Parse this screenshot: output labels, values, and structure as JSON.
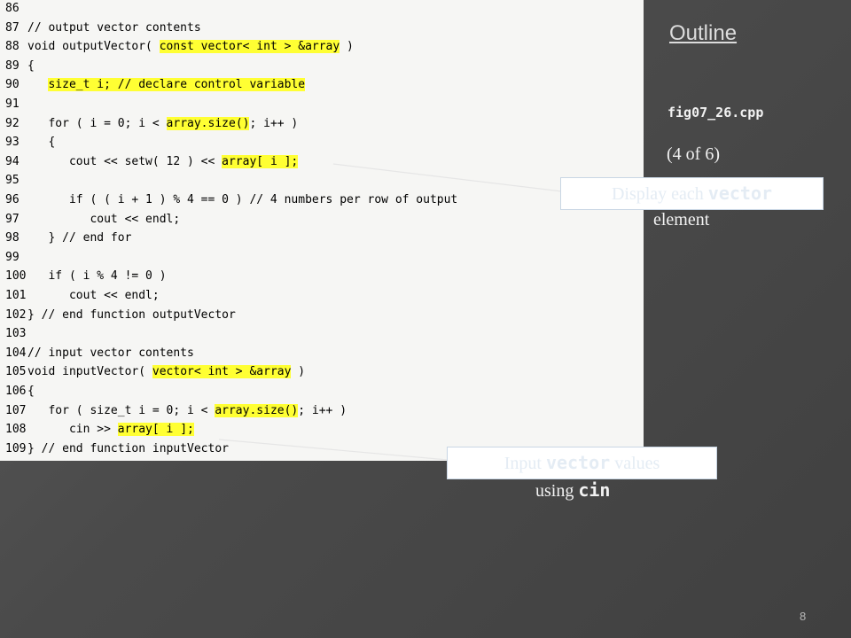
{
  "outline": {
    "title": "Outline",
    "file": "fig07_26.cpp",
    "page": "(4 of 6)"
  },
  "code_lines": [
    {
      "num": "86",
      "segs": []
    },
    {
      "num": "87",
      "segs": [
        {
          "t": "// output vector contents",
          "hl": false
        }
      ]
    },
    {
      "num": "88",
      "segs": [
        {
          "t": "void outputVector( ",
          "hl": false
        },
        {
          "t": "const vector< int > &array",
          "hl": true
        },
        {
          "t": " )",
          "hl": false
        }
      ]
    },
    {
      "num": "89",
      "segs": [
        {
          "t": "{",
          "hl": false
        }
      ]
    },
    {
      "num": "90",
      "segs": [
        {
          "t": "   ",
          "hl": false
        },
        {
          "t": "size_t i; // declare control variable",
          "hl": true
        }
      ]
    },
    {
      "num": "91",
      "segs": []
    },
    {
      "num": "92",
      "segs": [
        {
          "t": "   for ( i = 0; i < ",
          "hl": false
        },
        {
          "t": "array.size()",
          "hl": true
        },
        {
          "t": "; i++ )",
          "hl": false
        }
      ]
    },
    {
      "num": "93",
      "segs": [
        {
          "t": "   {",
          "hl": false
        }
      ]
    },
    {
      "num": "94",
      "segs": [
        {
          "t": "      cout << setw( 12 ) << ",
          "hl": false
        },
        {
          "t": "array[ i ];",
          "hl": true
        }
      ]
    },
    {
      "num": "95",
      "segs": []
    },
    {
      "num": "96",
      "segs": [
        {
          "t": "      if ( ( i + 1 ) % 4 == 0 ) // 4 numbers per row of output",
          "hl": false
        }
      ]
    },
    {
      "num": "97",
      "segs": [
        {
          "t": "         cout << endl;",
          "hl": false
        }
      ]
    },
    {
      "num": "98",
      "segs": [
        {
          "t": "   } // end for",
          "hl": false
        }
      ]
    },
    {
      "num": "99",
      "segs": []
    },
    {
      "num": "100",
      "segs": [
        {
          "t": "   if ( i % 4 != 0 )",
          "hl": false
        }
      ]
    },
    {
      "num": "101",
      "segs": [
        {
          "t": "      cout << endl;",
          "hl": false
        }
      ]
    },
    {
      "num": "102",
      "segs": [
        {
          "t": "} // end function outputVector",
          "hl": false
        }
      ]
    },
    {
      "num": "103",
      "segs": []
    },
    {
      "num": "104",
      "segs": [
        {
          "t": "// input vector contents",
          "hl": false
        }
      ]
    },
    {
      "num": "105",
      "segs": [
        {
          "t": "void inputVector( ",
          "hl": false
        },
        {
          "t": "vector< int > &array",
          "hl": true
        },
        {
          "t": " )",
          "hl": false
        }
      ]
    },
    {
      "num": "106",
      "segs": [
        {
          "t": "{",
          "hl": false
        }
      ]
    },
    {
      "num": "107",
      "segs": [
        {
          "t": "   for ( size_t i = 0; i < ",
          "hl": false
        },
        {
          "t": "array.size()",
          "hl": true
        },
        {
          "t": "; i++ )",
          "hl": false
        }
      ]
    },
    {
      "num": "108",
      "segs": [
        {
          "t": "      cin >> ",
          "hl": false
        },
        {
          "t": "array[ i ];",
          "hl": true
        }
      ]
    },
    {
      "num": "109",
      "segs": [
        {
          "t": "} // end function inputVector",
          "hl": false
        }
      ]
    }
  ],
  "callouts": {
    "display": {
      "pre": "Display each ",
      "mono": "vector",
      "tail": "element"
    },
    "input": {
      "pre": "Input ",
      "mono": "vector",
      "post": " values",
      "tail_pre": "using ",
      "tail_mono": "cin"
    }
  },
  "highlight_color": "#ffff33",
  "slide_number": "8"
}
